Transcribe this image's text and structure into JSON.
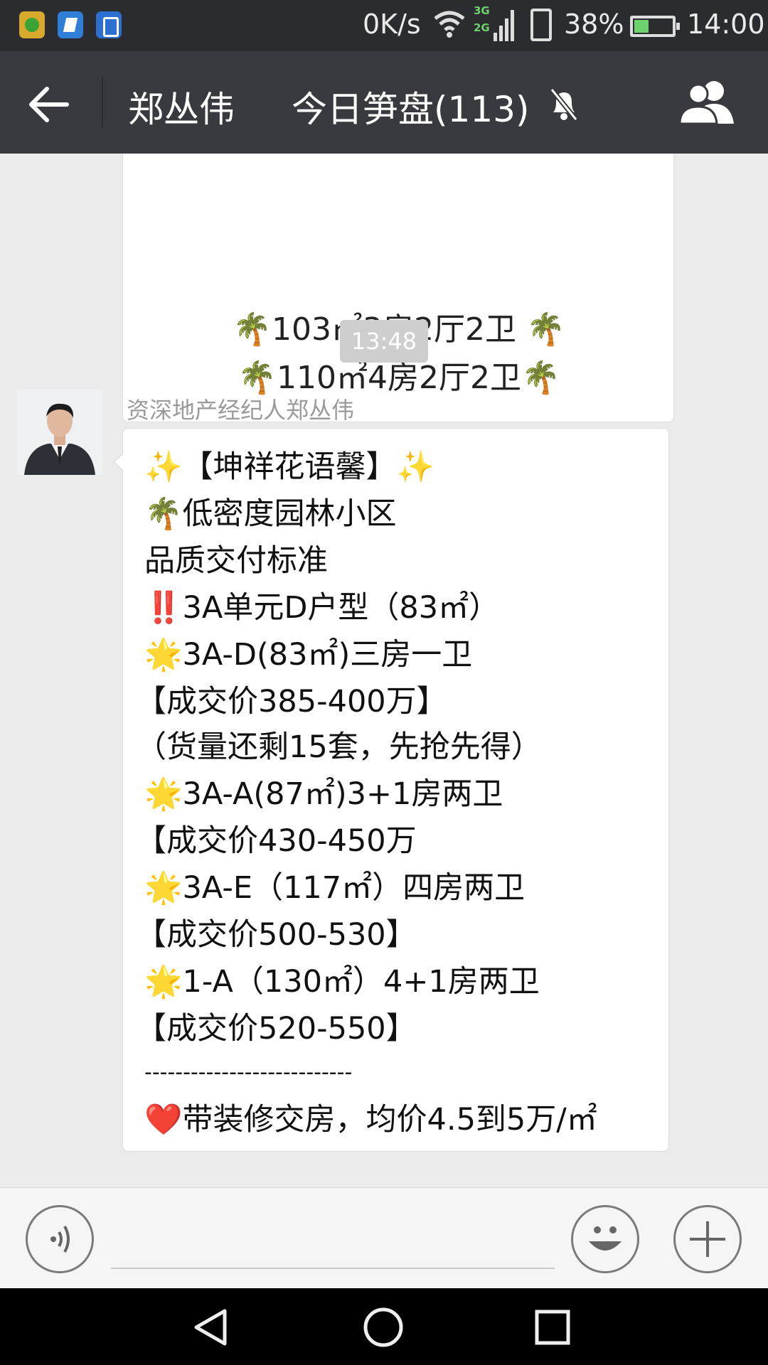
{
  "status_bar": {
    "speed": "0K/s",
    "network_labels": [
      "3G",
      "2G"
    ],
    "battery_percent": "38%",
    "time": "14:00"
  },
  "header": {
    "contact_name": "郑丛伟",
    "group_title": "今日笋盘(113)",
    "icons": [
      "back-arrow-icon",
      "mute-bell-icon",
      "group-members-icon"
    ]
  },
  "chat": {
    "previous_message_lines": [
      "🌴103㎡3房2厅2卫 🌴",
      "🌴110㎡4房2厅2卫🌴"
    ],
    "timestamp": "13:48",
    "sender_name": "资深地产经纪人郑丛伟",
    "message_lines": [
      "✨【坤祥花语馨】✨",
      "🌴低密度园林小区",
      "品质交付标准",
      "‼️3A单元D户型（83㎡）",
      "🌟3A-D(83㎡)三房一卫",
      "【成交价385-400万】",
      "（货量还剩15套，先抢先得）",
      "🌟3A-A(87㎡)3+1房两卫",
      "【成交价430-450万",
      "🌟3A-E（117㎡）四房两卫",
      "【成交价500-530】",
      "🌟1-A（130㎡）4+1房两卫",
      "【成交价520-550】",
      "---------------------------",
      "❤️带装修交房，均价4.5到5万/㎡"
    ]
  },
  "input_bar": {
    "icons": [
      "voice-icon",
      "emoji-icon",
      "plus-icon"
    ]
  },
  "nav_bar": {
    "icons": [
      "nav-back-icon",
      "nav-home-icon",
      "nav-recent-icon"
    ]
  }
}
